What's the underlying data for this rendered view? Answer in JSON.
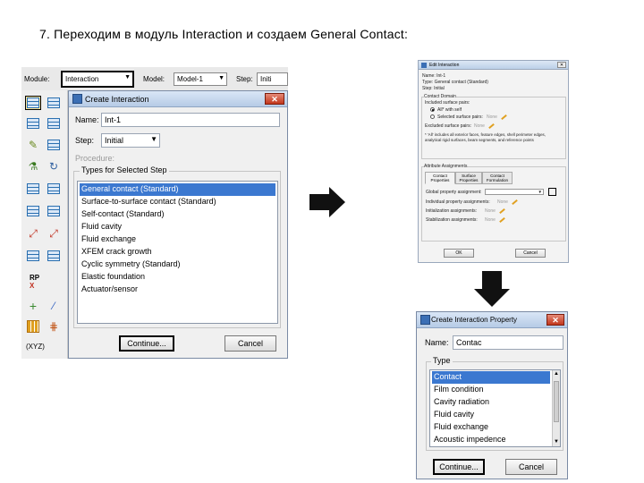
{
  "slide_title": "7. Переходим в модуль Interaction и создаем General Contact:",
  "toolbar": {
    "module_label": "Module:",
    "module_value": "Interaction",
    "model_label": "Model:",
    "model_value": "Model-1",
    "step_label": "Step:",
    "step_value": "Initi"
  },
  "toolbox": {
    "rp_label": "RP",
    "x_label": "X",
    "coords_label": "(XYZ)"
  },
  "create_interaction": {
    "title": "Create Interaction",
    "close": "✕",
    "name_label": "Name:",
    "name_value": "Int-1",
    "step_label": "Step:",
    "step_value": "Initial",
    "procedure_label": "Procedure:",
    "types_legend": "Types for Selected Step",
    "types": [
      "General contact (Standard)",
      "Surface-to-surface contact (Standard)",
      "Self-contact (Standard)",
      "Fluid cavity",
      "Fluid exchange",
      "XFEM crack growth",
      "Cyclic symmetry (Standard)",
      "Elastic foundation",
      "Actuator/sensor"
    ],
    "selected_index": 0,
    "continue_label": "Continue...",
    "cancel_label": "Cancel"
  },
  "edit_interaction": {
    "title": "Edit Interaction",
    "close": "✕",
    "name_line": "Name: Int-1",
    "type_line": "Type:   General contact (Standard)",
    "step_line": "Step:   Initial",
    "contact_domain": "Contact Domain",
    "included_pairs": "Included surface pairs:",
    "all_self": "All* with self",
    "selected_pairs": "Selected surface pairs:",
    "none1": "None",
    "excluded_pairs": "Excluded surface pairs:",
    "none2": "None",
    "note": "* 'All' includes all exterior faces, feature edges, shell perimeter edges, analytical rigid surfaces, beam segments, and reference points",
    "attr_assign": "Attribute Assignments",
    "tabs": [
      "Contact Properties",
      "Surface Properties",
      "Contact Formulation"
    ],
    "global_prop": "Global property assignment:",
    "indiv_prop": "Individual property assignments:",
    "none3": "None",
    "init_assign": "Initialization assignments:",
    "none4": "None",
    "stab_assign": "Stabilization assignments:",
    "none5": "None",
    "ok_label": "OK",
    "cancel_label": "Cancel"
  },
  "create_property": {
    "title": "Create Interaction Property",
    "close": "✕",
    "name_label": "Name:",
    "name_value": "Contac",
    "type_legend": "Type",
    "types": [
      "Contact",
      "Film condition",
      "Cavity radiation",
      "Fluid cavity",
      "Fluid exchange",
      "Acoustic impedence"
    ],
    "selected_index": 0,
    "continue_label": "Continue...",
    "cancel_label": "Cancel"
  },
  "colors": {
    "selection": "#3b78d0",
    "arrow": "#111111",
    "close": "#c2361c"
  }
}
